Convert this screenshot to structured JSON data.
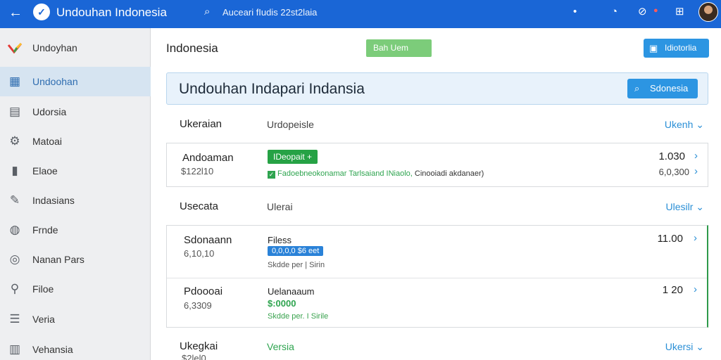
{
  "topbar": {
    "title": "Undouhan Indonesia",
    "search_text": "Auceari fIudis 22st2laia",
    "icons": [
      "back-arrow-icon",
      "app-logo-icon",
      "search-icon",
      "dot-icon",
      "help-icon",
      "toggle-icon",
      "grid-icon",
      "avatar"
    ]
  },
  "sidebar": {
    "items": [
      {
        "label": "Undoyhan",
        "icon": "brand-logo-icon"
      },
      {
        "label": "Undoohan",
        "icon": "grid-icon"
      },
      {
        "label": "Udorsia",
        "icon": "list-icon"
      },
      {
        "label": "Matoai",
        "icon": "gear-icon"
      },
      {
        "label": "Elaoe",
        "icon": "document-icon"
      },
      {
        "label": "Indasians",
        "icon": "pen-icon"
      },
      {
        "label": "Frnde",
        "icon": "globe-icon"
      },
      {
        "label": "Nanan Pars",
        "icon": "target-icon"
      },
      {
        "label": "Filoe",
        "icon": "tool-icon"
      },
      {
        "label": "Veria",
        "icon": "menu-icon"
      },
      {
        "label": "Vehansia",
        "icon": "layers-icon"
      }
    ]
  },
  "main": {
    "title": "Indonesia",
    "green_button": "Bah Uem",
    "blue_button": "Idiotorlia",
    "banner": {
      "title": "Undouhan  Indapari Indansia",
      "button": "Sdonesia"
    },
    "section1": {
      "col1": "Ukeraian",
      "col2": "Urdopeisle",
      "action": "Ukenh"
    },
    "card1": {
      "name": "Andoaman",
      "amount": "$122l10",
      "tag": "IDeopait +",
      "note_green": "Fadoebneokonamar Tarlsaiand INiaolo,",
      "note_gray": "Cinooiadi akdanaer)",
      "value1": "1.030",
      "value2": "6,0,300"
    },
    "section2": {
      "col1": "Usecata",
      "col2": "Ulerai",
      "action": "Ulesilr"
    },
    "card2": {
      "rows": [
        {
          "name": "Sdonaann",
          "sub": "6,10,10",
          "title": "Filess",
          "tag": "0,0,0,0 $6 eet",
          "note": "Skdde per | Sirin",
          "value": "11.00"
        },
        {
          "name": "Pdoooai",
          "sub": "6,3309",
          "title": "Uelanaaum",
          "price": "$:0000",
          "note": "Skdde per. I Sirile",
          "value": "1 20"
        }
      ]
    },
    "section3": {
      "col1": "Ukegkai",
      "sub": "$2lel0",
      "col2": "Versia",
      "action": "Ukersi"
    }
  },
  "colors": {
    "topbar": "#1a66d6",
    "accent_blue": "#2c95e2",
    "accent_green": "#26a245",
    "sidebar_bg": "#eeeff1",
    "active_item": "#d6e4f1"
  }
}
